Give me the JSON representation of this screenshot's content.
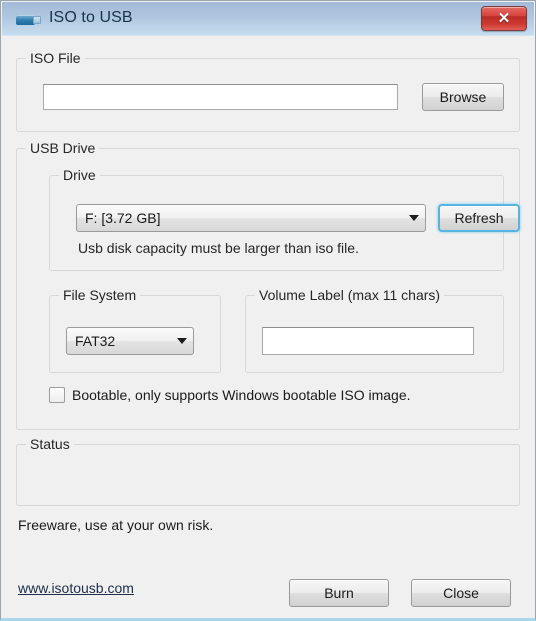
{
  "window": {
    "title": "ISO to USB",
    "app_icon": "usb-drive-icon",
    "close_label": "✕",
    "accent_focus_color": "#56b4e0",
    "titlebar_color": "#aec6de",
    "close_button_color": "#d8453f",
    "background_color": "#f0f0f0"
  },
  "iso_file": {
    "group_label": "ISO File",
    "path_value": "",
    "path_placeholder": "",
    "browse_label": "Browse"
  },
  "usb_drive": {
    "group_label": "USB Drive",
    "drive": {
      "group_label": "Drive",
      "selected": "F: [3.72 GB]",
      "options": [
        "F: [3.72 GB]"
      ],
      "refresh_label": "Refresh",
      "hint": "Usb disk capacity must be larger than iso file."
    },
    "file_system": {
      "group_label": "File System",
      "selected": "FAT32",
      "options": [
        "FAT32"
      ]
    },
    "volume_label": {
      "group_label": "Volume Label (max 11 chars)",
      "value": "",
      "placeholder": ""
    },
    "bootable": {
      "label": "Bootable, only supports Windows bootable ISO image.",
      "checked": false
    }
  },
  "status": {
    "group_label": "Status",
    "text": ""
  },
  "footer": {
    "freeware_notice": "Freeware, use at your own risk.",
    "website": "www.isotousb.com",
    "burn_label": "Burn",
    "close_label": "Close"
  }
}
